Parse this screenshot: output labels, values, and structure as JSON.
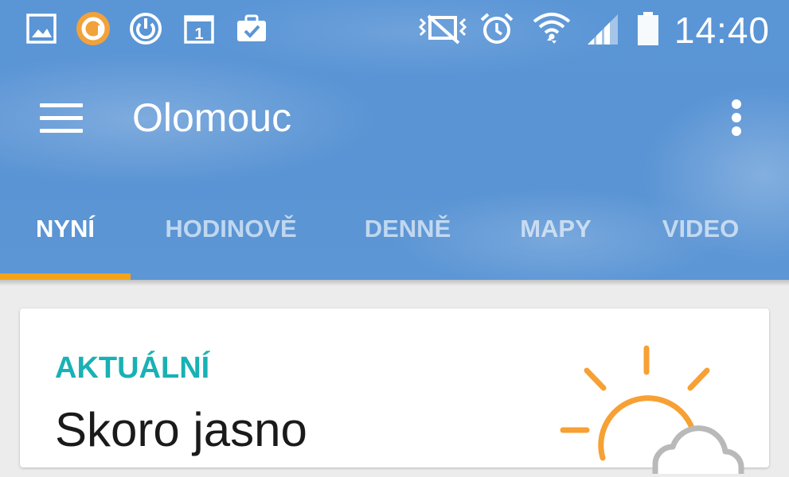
{
  "status_bar": {
    "time": "14:40",
    "left_icons": [
      "gallery-icon",
      "app-circle-icon",
      "power-sync-icon",
      "calendar-icon",
      "briefcase-check-icon"
    ],
    "right_icons": [
      "vibrate-mute-icon",
      "alarm-icon",
      "wifi-icon",
      "signal-icon",
      "battery-icon"
    ],
    "calendar_day": "1"
  },
  "toolbar": {
    "title": "Olomouc"
  },
  "tabs": [
    {
      "label": "NYNÍ",
      "active": true
    },
    {
      "label": "HODINOVĚ",
      "active": false
    },
    {
      "label": "DENNĚ",
      "active": false
    },
    {
      "label": "MAPY",
      "active": false
    },
    {
      "label": "VIDEO",
      "active": false
    }
  ],
  "current": {
    "label": "AKTUÁLNÍ",
    "description": "Skoro jasno",
    "icon": "partly-sunny-icon"
  },
  "colors": {
    "header_blue": "#5a95d6",
    "tab_indicator": "#f5a31a",
    "label_teal": "#19b1b5",
    "sun_orange": "#f7a034",
    "cloud_gray": "#b9b9b9"
  }
}
